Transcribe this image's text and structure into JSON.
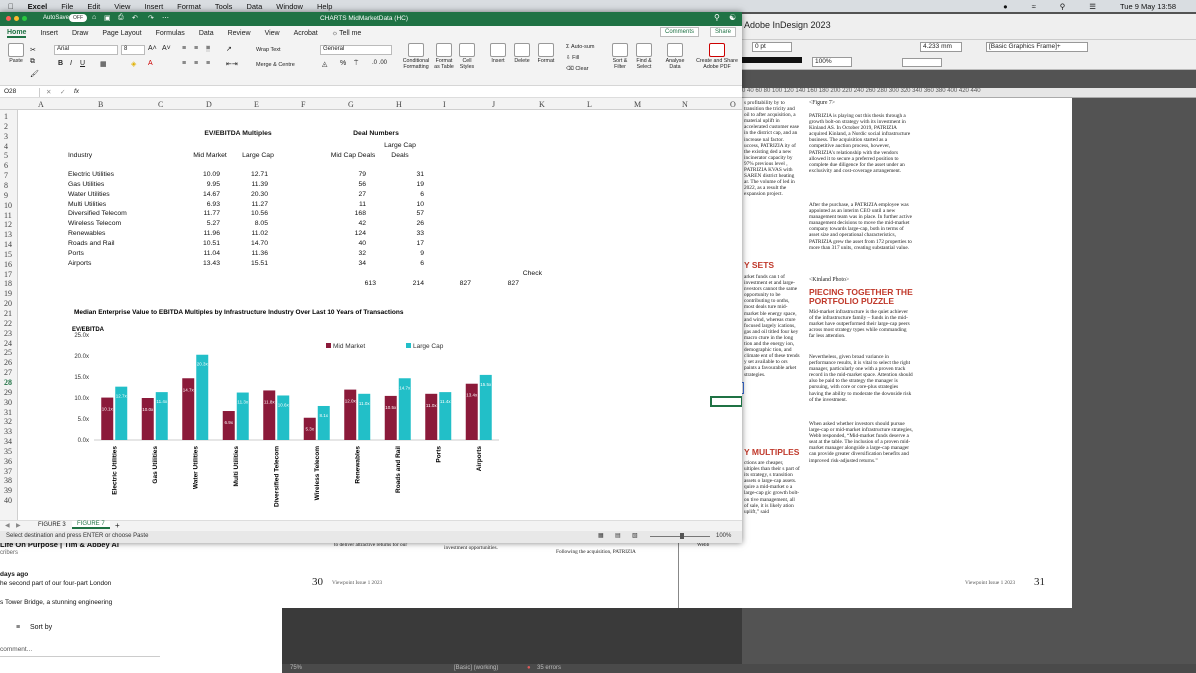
{
  "mac_menu": {
    "apple": "",
    "app": "Excel",
    "items": [
      "File",
      "Edit",
      "View",
      "Insert",
      "Format",
      "Tools",
      "Data",
      "Window",
      "Help"
    ],
    "clock": "Tue 9 May 13:58"
  },
  "excel": {
    "autosave": "AutoSave",
    "autosave_state": "OFF",
    "title": "CHARTS MidMarketData (HC)",
    "tabs": [
      "Home",
      "Insert",
      "Draw",
      "Page Layout",
      "Formulas",
      "Data",
      "Review",
      "View",
      "Acrobat"
    ],
    "tell_me": "Tell me",
    "comments": "Comments",
    "share": "Share",
    "ribbon": {
      "paste": "Paste",
      "font": "Arial",
      "size": "8",
      "wrap": "Wrap Text",
      "merge": "Merge & Centre",
      "numfmt": "General",
      "cond": "Conditional\nFormatting",
      "fmt_table": "Format\nas Table",
      "cell_styles": "Cell\nStyles",
      "insert": "Insert",
      "delete": "Delete",
      "format": "Format",
      "autosum": "Auto-sum",
      "fill": "Fill",
      "clear": "Clear",
      "sort": "Sort &\nFilter",
      "find": "Find &\nSelect",
      "analyse": "Analyse\nData",
      "create_pdf": "Create and Share\nAdobe PDF"
    },
    "name_box": "O28",
    "fx": "fx",
    "columns": [
      "A",
      "B",
      "C",
      "D",
      "E",
      "F",
      "G",
      "H",
      "I",
      "J",
      "K",
      "L",
      "M",
      "N",
      "O"
    ],
    "rows": [
      "1",
      "2",
      "3",
      "4",
      "5",
      "6",
      "7",
      "8",
      "9",
      "10",
      "11",
      "12",
      "13",
      "14",
      "15",
      "16",
      "17",
      "18",
      "19",
      "20",
      "21",
      "22",
      "23",
      "24",
      "25",
      "26",
      "27",
      "28",
      "29",
      "30",
      "31",
      "32",
      "33",
      "34",
      "35",
      "36",
      "37",
      "38",
      "39",
      "40"
    ],
    "header_ev": "EV/EBITDA Multiples",
    "header_deal": "Deal Numbers",
    "col_industry": "Industry",
    "col_mid": "Mid Market",
    "col_large": "Large Cap",
    "col_midd": "Mid Cap Deals",
    "col_larged_1": "Large Cap",
    "col_larged_2": "Deals",
    "table": [
      [
        "Electric Utilities",
        "10.09",
        "12.71",
        "79",
        "31"
      ],
      [
        "Gas Utilities",
        "9.95",
        "11.39",
        "56",
        "19"
      ],
      [
        "Water Utilities",
        "14.67",
        "20.30",
        "27",
        "6"
      ],
      [
        "Multi Utilities",
        "6.93",
        "11.27",
        "11",
        "10"
      ],
      [
        "Diversified Telecom",
        "11.77",
        "10.56",
        "168",
        "57"
      ],
      [
        "Wireless Telecom",
        "5.27",
        "8.05",
        "42",
        "26"
      ],
      [
        "Renewables",
        "11.96",
        "11.02",
        "124",
        "33"
      ],
      [
        "Roads and Rail",
        "10.51",
        "14.70",
        "40",
        "17"
      ],
      [
        "Ports",
        "11.04",
        "11.36",
        "32",
        "9"
      ],
      [
        "Airports",
        "13.43",
        "15.51",
        "34",
        "6"
      ]
    ],
    "totals": {
      "g": "613",
      "h": "214",
      "i": "827",
      "check_label": "Check",
      "j": "827"
    },
    "sheet_tabs": [
      "FIGURE 3",
      "FIGURE 7"
    ],
    "active_sheet": "FIGURE 7",
    "status": "Select destination and press ENTER or choose Paste",
    "zoom": "100%"
  },
  "chart_data": {
    "type": "bar",
    "title": "Median Enterprise Value to EBITDA Multiples by Infrastructure Industry Over Last 10 Years of Transactions",
    "ylabel": "EV/EBITDA",
    "ylim": [
      0,
      25
    ],
    "yticks": [
      "0.0x",
      "5.0x",
      "10.0x",
      "15.0x",
      "20.0x",
      "25.0x"
    ],
    "categories": [
      "Electric Utilities",
      "Gas Utilities",
      "Water Utilities",
      "Multi Utilities",
      "Diversified Telecom",
      "Wireless Telecom",
      "Renewables",
      "Roads and Rail",
      "Ports",
      "Airports"
    ],
    "series": [
      {
        "name": "Mid Market",
        "color": "#8b1a3a",
        "values": [
          10.1,
          10.0,
          14.7,
          6.9,
          11.8,
          5.3,
          12.0,
          10.5,
          11.0,
          13.4
        ],
        "labels": [
          "10.1x",
          "10.0x",
          "14.7x",
          "6.9x",
          "11.8x",
          "5.3x",
          "12.0x",
          "10.5x",
          "11.0x",
          "13.4x"
        ]
      },
      {
        "name": "Large Cap",
        "color": "#22bfc8",
        "values": [
          12.7,
          11.4,
          20.3,
          11.3,
          10.6,
          8.1,
          11.0,
          14.7,
          11.4,
          15.5
        ],
        "labels": [
          "12.7x",
          "11.4x",
          "20.3x",
          "11.3x",
          "10.6x",
          "8.1x",
          "11.0x",
          "14.7x",
          "11.4x",
          "15.5x"
        ]
      }
    ],
    "grid": false,
    "legend": "top-right"
  },
  "indesign": {
    "title": "Adobe InDesign 2023",
    "pt": "0 pt",
    "mm": "4.233 mm",
    "frame": "[Basic Graphics Frame]+",
    "zoom": "100%",
    "ruler": "0  40  60  80  100  120  140  160  180  200  220  240  260  280  300  320  340  360  380  400  420  440",
    "fig_tag": "<Figure 7>",
    "para1": "PATRIZIA is playing out this thesis through a growth bolt-on strategy with its investment in Kinland AS. In October 2019, PATRIZIA acquired Kinland, a Nordic social infrastructure business. The acquisition started as a competitive auction process, however, PATRIZIA's relationship with the vendors allowed it to secure a preferred position to complete due diligence for the asset under an exclusivity and cost-coverage arrangement.",
    "para2": "After the purchase, a PATRIZIA employee was appointed as an interim CEO until a new management team was in place. In further active management decisions to move the mid-market company towards large-cap, both in terms of asset size and operational characteristics, PATRIZIA grew the asset from 172 properties to more than 317 units, creating substantial value.",
    "photo_tag": "<Kinland Photo>",
    "heading": "PIECING TOGETHER THE PORTFOLIO PUZZLE",
    "para3": "Mid-market infrastructure is the quiet achiever of the infrastructure family – funds in the mid-market have outperformed their large-cap peers across most strategy types while commanding far less attention.",
    "para4": "Nevertheless, given broad variance in performance results, it is vital to select the right manager, particularly one with a proven track record in the mid-market space. Attention should also be paid to the strategy the manager is pursuing, with core or core-plus strategies having the ability to moderate the downside risk of the investment.",
    "para5": "When asked whether investors should pursue large-cap or mid-market infrastructure strategies, Webb responded, “Mid-market funds deserve a seat at the table. The inclusion of a proven mid-market manager alongside a large-cap manager can provide greater diversification benefits and improved risk-adjusted returns.”",
    "left_col": "s profitability by to transition the tricity and oil to after acquisition, a material uplift in accelerated customer ease in the district cap, and an increase nal factor. uccess, PATRIZIA ity of the existing ded a new incinerator capacity by 97% previous level , PATRIZIA KVAS with SAREN district heating ar. The volume of led in 2022, as a result the expansion project.",
    "left_head1": "Y SETS",
    "left_col2": "arket funds can t of investment et and large- nvestors cannot the same opportunity to be contributing to onths, most deals ture mid-market ble energy space, and wind, whereas cture focused largely ications, gas and oil titled four key macro cture in the long tion and the energy ion, demographic tion, and climate ent of these trends y set available to ors paints a favourable arket strategies.",
    "left_head2": "Y MULTIPLES",
    "left_col3": "ctions are cheaper, ultiples than their s part of its strategy, s transition assets o large-cap assets. quire a mid-market o a large-cap gic growth bolt-on tive management, all of sale, it is likely ation uplift,” said",
    "footer_left_page": "30",
    "footer_left": "Viewpoint Issue 1 2023",
    "footer_right": "Viewpoint Issue 1 2023",
    "footer_right_page": "31",
    "bottom_text1": "to deliver attractive returns for our",
    "bottom_text2": "investment opportunities.",
    "bottom_text3": "Following the acquisition, PATRIZIA",
    "bottom_text4": "Webb",
    "status_zoom": "75%",
    "status_style": "[Basic] (working)",
    "status_errors": "35 errors"
  },
  "podcast": {
    "title": "Life On Purpose | Tim & Abbey Al",
    "sub": "cribers",
    "time": "days ago",
    "desc1": "he second part of our four-part London",
    "desc2": "s Tower Bridge, a stunning engineering",
    "sort": "Sort by",
    "comment": "comment..."
  }
}
